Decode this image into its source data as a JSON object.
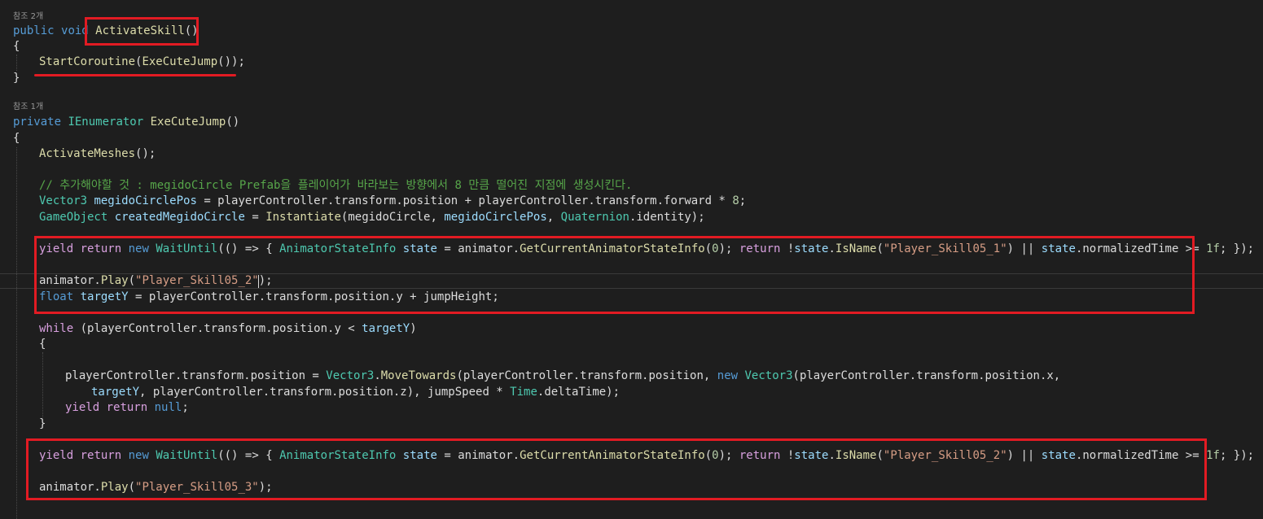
{
  "codelens": [
    "참조 2개",
    "참조 1개"
  ],
  "tok": {
    "public": "public",
    "void": "void",
    "ActivateSkill": "ActivateSkill",
    "paren": "()",
    "lbrace": "{",
    "rbrace": "}",
    "StartCoroutine": "StartCoroutine",
    "lp": "(",
    "ExeCuteJump": "ExeCuteJump",
    "endStart": "());",
    "private": "private",
    "IEnumerator": "IEnumerator",
    "ActivateMeshes": "ActivateMeshes",
    "callEnd": "();",
    "comment": "// 추가해야할 것 : megidoCircle Prefab을 플레이어가 바라보는 방향에서 8 만큼 떨어진 지점에 생성시킨다.",
    "Vector3": "Vector3",
    "sp": " ",
    "megidoCirclePos": "megidoCirclePos",
    "l8b": " = playerController.transform.position + playerController.transform.forward * ",
    "eight": "8",
    "semi": ";",
    "GameObject": "GameObject",
    "createdMegidoCircle": "createdMegidoCircle",
    "eq": " = ",
    "Instantiate": "Instantiate",
    "l9a": "(megidoCircle, ",
    "comma": ", ",
    "Quaternion": "Quaternion",
    "dotIdentity": ".identity);",
    "yield": "yield",
    "return": "return",
    "new": "new",
    "WaitUntil": "WaitUntil",
    "lambdaOpen": "(() => { ",
    "AnimatorStateInfo": "AnimatorStateInfo",
    "state": "state",
    "animatorDot": " = animator.",
    "GetCurrentAnimatorStateInfo": "GetCurrentAnimatorStateInfo",
    "zero": "0",
    "rpSemi": "); ",
    "bang": " !",
    "dot": ".",
    "IsName": "IsName",
    "s1": "\"Player_Skill05_1\"",
    "orOp": ") || ",
    "normTimeGe": ".normalizedTime >= ",
    "oneF": "1f",
    "lambdaClose": "; });",
    "animatorPlay": "animator.",
    "Play": "Play",
    "s2": "\"Player_Skill05_2\"",
    "rpSemiEnd": ");",
    "float": "float",
    "targetY": "targetY",
    "l13b": " = playerController.transform.position.y + jumpHeight;",
    "while": "while",
    "whileMid": " (playerController.transform.position.y < ",
    "rp": ")",
    "ptp": "playerController.transform.position = ",
    "MoveTowards": "MoveTowards",
    "mtMid": "(playerController.transform.position, ",
    "ptpx": "(playerController.transform.position.x,",
    "l18b": ", playerController.transform.position.z), jumpSpeed * ",
    "Time": "Time",
    "deltaTime": ".deltaTime);",
    "null": "null",
    "s3": "\"Player_Skill05_3\""
  }
}
